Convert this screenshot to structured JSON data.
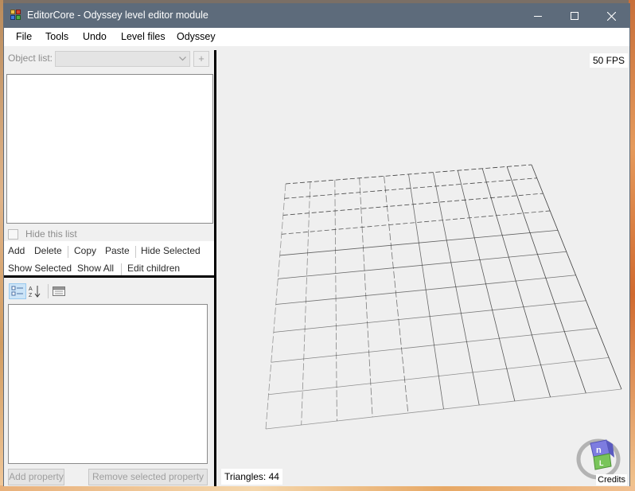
{
  "window": {
    "title": "EditorCore - Odyssey level editor module",
    "controls": [
      "minimize",
      "maximize",
      "close"
    ]
  },
  "menu": {
    "items": [
      "File",
      "Tools",
      "Undo",
      "Level files",
      "Odyssey"
    ]
  },
  "object_list": {
    "label": "Object list:",
    "selected_value": "",
    "add_label": "+",
    "hide_list_label": "Hide this list",
    "hide_list_checked": false
  },
  "toolbar": {
    "row1": [
      "Add",
      "Delete",
      "Copy",
      "Paste",
      "Hide Selected"
    ],
    "row2": [
      "Show Selected",
      "Show All",
      "Edit children"
    ]
  },
  "property_panel": {
    "toolbar_icons": [
      "categorized-icon",
      "alphabetical-sort-icon",
      "property-pages-icon"
    ],
    "add_property_label": "Add property",
    "remove_property_label": "Remove selected property"
  },
  "viewport": {
    "fps_text": "50 FPS",
    "triangles_text": "Triangles: 44",
    "credits_label": "Credits",
    "credits_letters": [
      "n",
      "L"
    ],
    "grid_rows": 10,
    "grid_cols": 10
  },
  "colors": {
    "titlebar": "#5d6b7b",
    "selected_tool": "#cce4f7",
    "viewport_bg": "#efefef"
  }
}
